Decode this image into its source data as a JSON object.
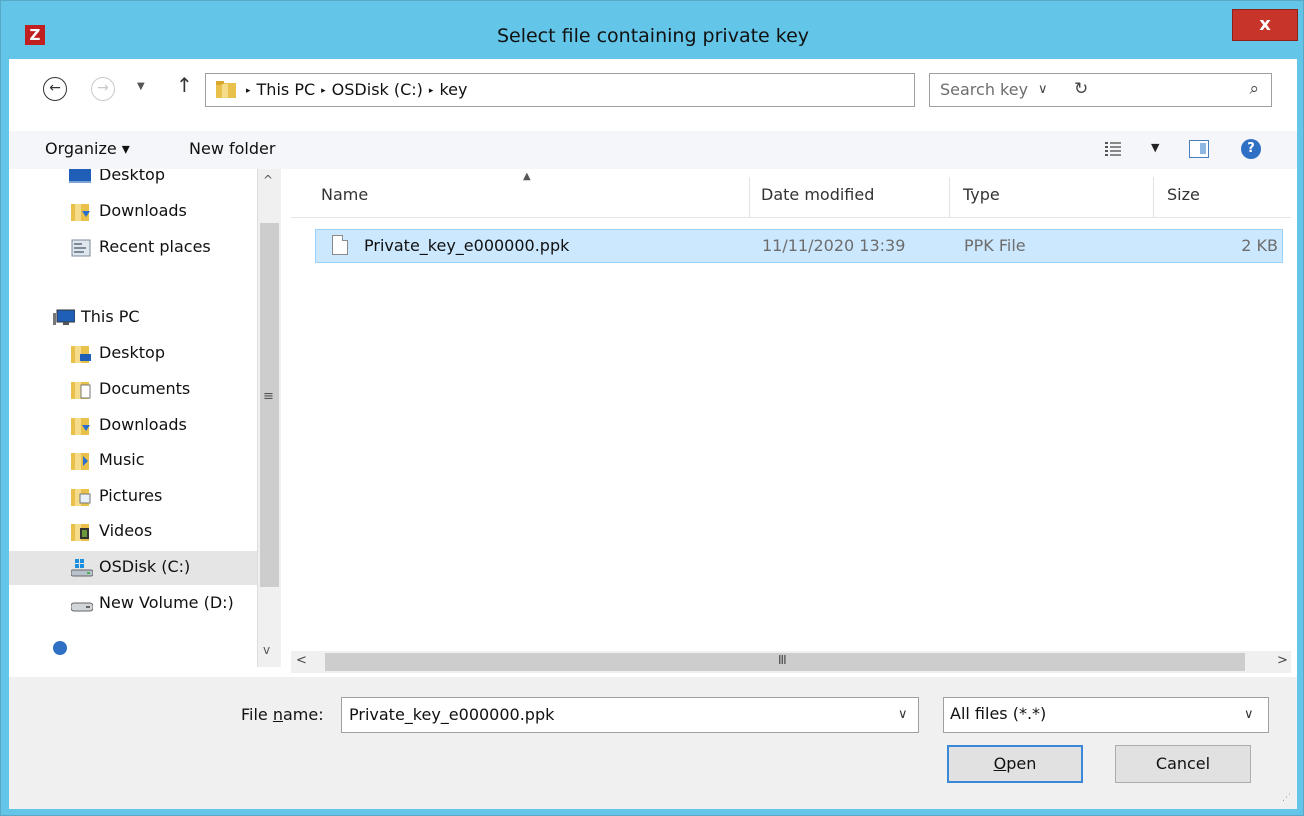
{
  "window": {
    "title": "Select file containing private key",
    "app_icon": "Z",
    "close_label": "x",
    "colors": {
      "titlebar": "#63c6e8",
      "close": "#c7342a",
      "selection": "#cce8ff",
      "selection_border": "#99d1ff"
    }
  },
  "address": {
    "breadcrumbs": [
      "This PC",
      "OSDisk (C:)",
      "key"
    ],
    "separator": "▸",
    "dropdown_icon": "chevron-down-icon",
    "refresh_icon": "refresh-icon"
  },
  "search": {
    "placeholder": "Search key",
    "icon": "search-icon"
  },
  "toolbar": {
    "organize": "Organize ▾",
    "new_folder": "New folder"
  },
  "nav": {
    "items": [
      {
        "label": "Desktop",
        "icon": "desktop-icon"
      },
      {
        "label": "Downloads",
        "icon": "downloads-folder-icon"
      },
      {
        "label": "Recent places",
        "icon": "recent-places-icon"
      },
      {
        "label": "This PC",
        "icon": "computer-icon"
      },
      {
        "label": "Desktop",
        "icon": "desktop-folder-icon"
      },
      {
        "label": "Documents",
        "icon": "documents-folder-icon"
      },
      {
        "label": "Downloads",
        "icon": "downloads-folder-icon"
      },
      {
        "label": "Music",
        "icon": "music-folder-icon"
      },
      {
        "label": "Pictures",
        "icon": "pictures-folder-icon"
      },
      {
        "label": "Videos",
        "icon": "videos-folder-icon"
      },
      {
        "label": "OSDisk (C:)",
        "icon": "system-drive-icon"
      },
      {
        "label": "New Volume (D:)",
        "icon": "drive-icon"
      }
    ],
    "selected": "OSDisk (C:)"
  },
  "filelist": {
    "columns": [
      "Name",
      "Date modified",
      "Type",
      "Size"
    ],
    "sorted_by": "Name",
    "rows": [
      {
        "name": "Private_key_e000000.ppk",
        "date": "11/11/2020 13:39",
        "type": "PPK File",
        "size": "2 KB",
        "selected": true
      }
    ]
  },
  "bottom": {
    "file_name_label_prefix": "File ",
    "file_name_label_accel": "n",
    "file_name_label_suffix": "ame:",
    "file_name_value": "Private_key_e000000.ppk",
    "filter_value": "All files (*.*)",
    "open_accel": "O",
    "open_rest": "pen",
    "cancel": "Cancel"
  }
}
